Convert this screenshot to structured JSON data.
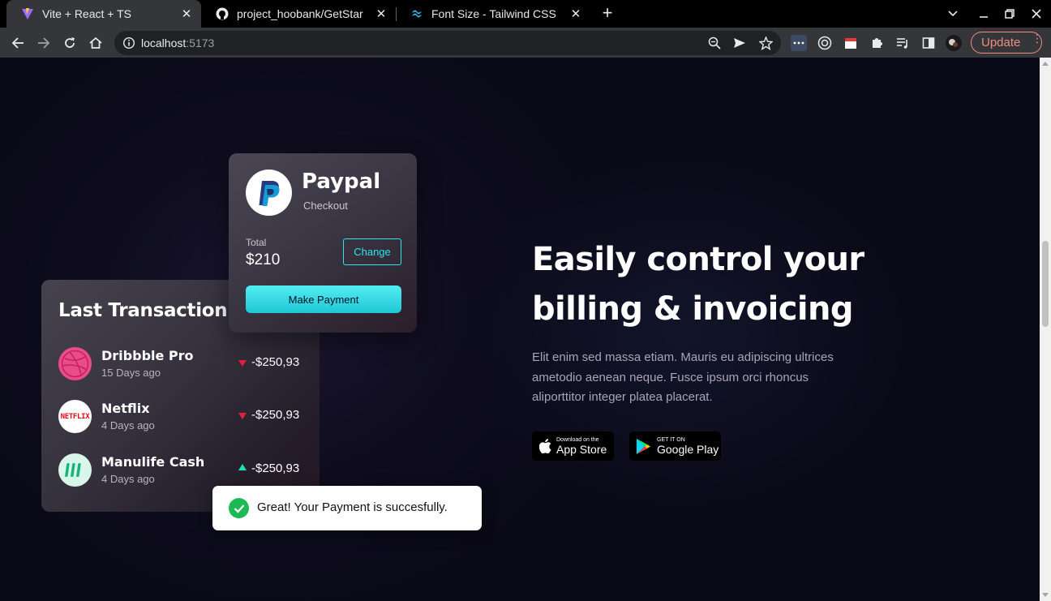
{
  "browser": {
    "tabs": [
      {
        "title": "Vite + React + TS",
        "active": true
      },
      {
        "title": "project_hoobank/GetStar",
        "active": false
      },
      {
        "title": "Font Size - Tailwind CSS",
        "active": false
      }
    ],
    "url_host": "localhost",
    "url_port": ":5173",
    "update_label": "Update"
  },
  "transactions": {
    "heading": "Last Transaction",
    "items": [
      {
        "name": "Dribbble Pro",
        "when": "15 Days ago",
        "amount": "-$250,93",
        "direction": "down"
      },
      {
        "name": "Netflix",
        "when": "4 Days ago",
        "amount": "-$250,93",
        "direction": "down"
      },
      {
        "name": "Manulife Cash",
        "when": "4 Days ago",
        "amount": "-$250,93",
        "direction": "up"
      }
    ],
    "netflix_logo_text": "NETFLIX"
  },
  "paypal": {
    "name": "Paypal",
    "subtitle": "Checkout",
    "total_label": "Total",
    "total_value": "$210",
    "change_label": "Change",
    "pay_label": "Make Payment"
  },
  "toast": {
    "message": "Great! Your Payment is succesfully."
  },
  "hero": {
    "headline_line1": "Easily control your",
    "headline_line2": "billing & invoicing",
    "paragraph": "Elit enim sed massa etiam. Mauris eu adipiscing ultrices ametodio aenean neque. Fusce ipsum orci rhoncus aliporttitor integer platea placerat."
  },
  "stores": {
    "apple_small": "Download on the",
    "apple_big": "App Store",
    "google_small": "GET IT ON",
    "google_big": "Google Play"
  },
  "colors": {
    "accent_cyan": "#2ce5ef",
    "down_red": "#e0213d",
    "up_teal": "#20e0b8",
    "success_green": "#1db954"
  }
}
